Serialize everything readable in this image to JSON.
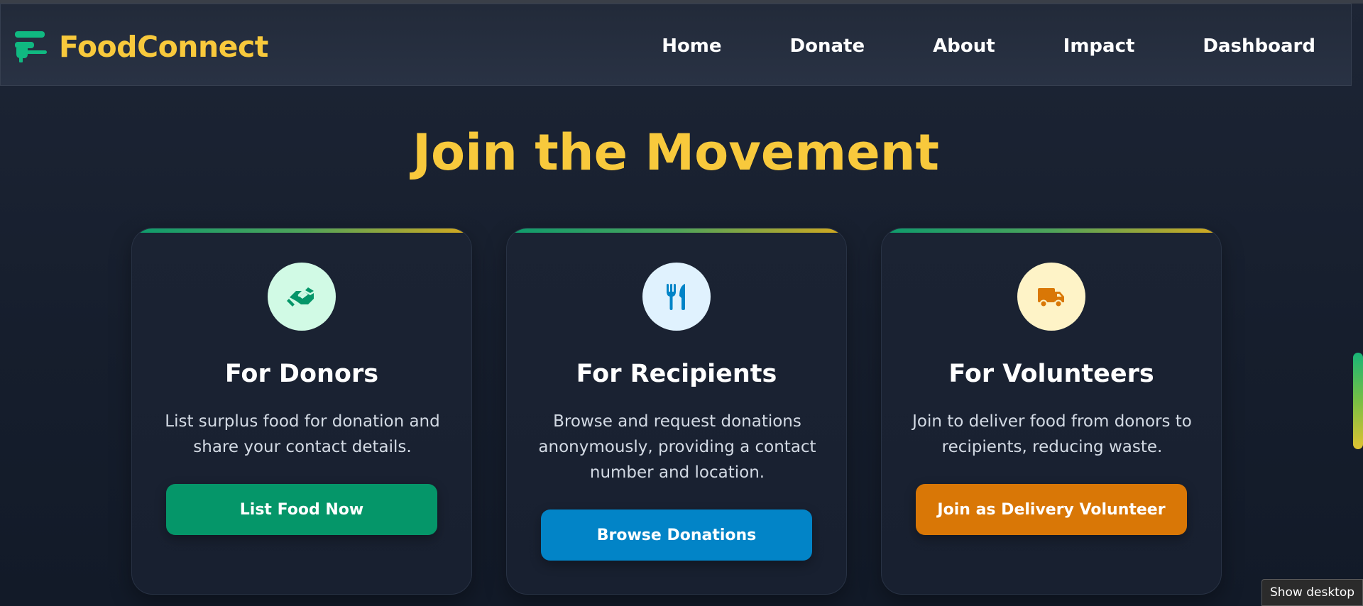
{
  "app": {
    "brand_name": "FoodConnect",
    "brand_icon": "fork-plate-logo-icon"
  },
  "nav": {
    "items": [
      {
        "label": "Home"
      },
      {
        "label": "Donate"
      },
      {
        "label": "About"
      },
      {
        "label": "Impact"
      },
      {
        "label": "Dashboard"
      }
    ]
  },
  "hero": {
    "title": "Join the Movement"
  },
  "cards": [
    {
      "icon": "handshake-icon",
      "icon_bg": "#d1fae5",
      "icon_color": "#059669",
      "title": "For Donors",
      "description": "List surplus food for donation and share your contact details.",
      "button_label": "List Food Now",
      "button_color": "#059669"
    },
    {
      "icon": "utensils-icon",
      "icon_bg": "#e0f2fe",
      "icon_color": "#0284c7",
      "title": "For Recipients",
      "description": "Browse and request donations anonymously, providing a contact number and location.",
      "button_label": "Browse Donations",
      "button_color": "#0284c7"
    },
    {
      "icon": "truck-icon",
      "icon_bg": "#fef3c7",
      "icon_color": "#d97706",
      "title": "For Volunteers",
      "description": "Join to deliver food from donors to recipients, reducing waste.",
      "button_label": "Join as Delivery Volunteer",
      "button_color": "#d97706"
    }
  ],
  "os": {
    "tooltip": "Show desktop"
  },
  "colors": {
    "accent_yellow": "#f8c93c",
    "accent_green": "#10b981",
    "background": "#161e2d"
  }
}
